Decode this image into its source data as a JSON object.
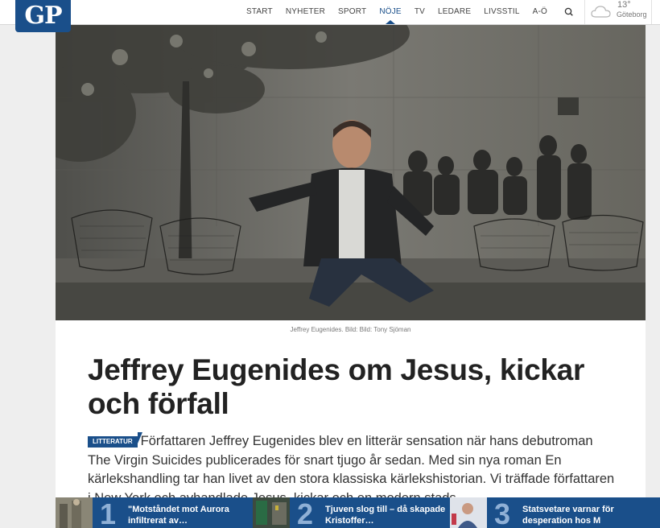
{
  "header": {
    "logo_text": "GP",
    "nav": [
      {
        "label": "START",
        "active": false
      },
      {
        "label": "NYHETER",
        "active": false
      },
      {
        "label": "SPORT",
        "active": false
      },
      {
        "label": "NÖJE",
        "active": true
      },
      {
        "label": "TV",
        "active": false
      },
      {
        "label": "LEDARE",
        "active": false
      },
      {
        "label": "LIVSSTIL",
        "active": false
      },
      {
        "label": "A-Ö",
        "active": false
      }
    ],
    "search_icon": "search-icon",
    "weather": {
      "icon": "cloud-icon",
      "temp": "13°",
      "city": "Göteborg"
    }
  },
  "article": {
    "caption": "Jeffrey Eugenides. Bild: Bild: Tony Sjöman",
    "headline": "Jeffrey Eugenides om Jesus, kickar och förfall",
    "tag": "LITTERATUR",
    "lead": "Författaren Jeffrey Eugenides blev en litterär sensation när hans debutroman The Virgin Suicides publicerades för snart tjugo år sedan. Med sin nya roman En kärlekshandling tar han livet av den stora klassiska kärlekshistorian. Vi träffade författaren i New York och avhandlade Jesus, kickar och en modern stads"
  },
  "most_read": [
    {
      "rank": "1",
      "title": "\"Motståndet mot Aurora infiltrerat av…"
    },
    {
      "rank": "2",
      "title": "Tjuven slog till – då skapade Kristoffer…"
    },
    {
      "rank": "3",
      "title": "Statsvetare varnar för desperation hos M"
    }
  ],
  "colors": {
    "brand": "#1a4f8a",
    "background": "#eeeeee"
  }
}
